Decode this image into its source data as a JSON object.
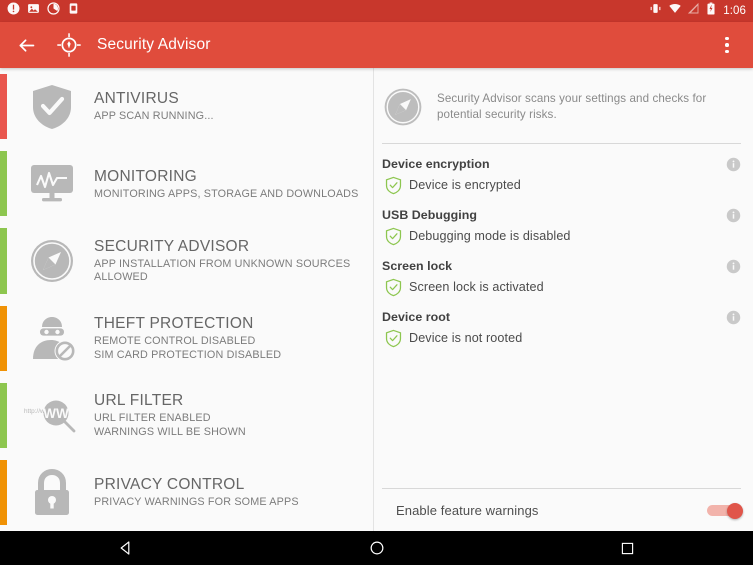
{
  "statusbar": {
    "icons_left": [
      "alert-circle-icon",
      "image-icon",
      "circle-progress-icon",
      "sim-card-icon"
    ],
    "icons_right": [
      "vibrate-icon",
      "wifi-icon",
      "signal-off-icon",
      "battery-icon"
    ],
    "clock": "1:06"
  },
  "appbar": {
    "back_icon": "back-arrow-icon",
    "logo_icon": "compass-target-icon",
    "title": "Security Advisor",
    "overflow_icon": "overflow-menu-icon",
    "background": "#e04c3c"
  },
  "colors": {
    "status_red": "#e9564e",
    "status_green": "#8dc64f",
    "status_orange": "#f09205",
    "accent": "#e04c3c",
    "check_green": "#8dc64f"
  },
  "sidebar": {
    "items": [
      {
        "title": "ANTIVIRUS",
        "lines": [
          "APP SCAN RUNNING..."
        ],
        "icon": "shield-check-icon",
        "stripe_color": "#e9564e"
      },
      {
        "title": "MONITORING",
        "lines": [
          "MONITORING APPS, STORAGE AND DOWNLOADS"
        ],
        "icon": "monitor-graph-icon",
        "stripe_color": "#8dc64f"
      },
      {
        "title": "SECURITY ADVISOR",
        "lines": [
          "APP INSTALLATION FROM UNKNOWN SOURCES",
          "ALLOWED"
        ],
        "icon": "compass-icon",
        "stripe_color": "#8dc64f"
      },
      {
        "title": "THEFT PROTECTION",
        "lines": [
          "REMOTE CONTROL DISABLED",
          "SIM CARD PROTECTION DISABLED"
        ],
        "icon": "thief-blocked-icon",
        "stripe_color": "#f09205"
      },
      {
        "title": "URL FILTER",
        "lines": [
          "URL FILTER ENABLED",
          "WARNINGS WILL BE SHOWN"
        ],
        "icon": "url-magnifier-icon",
        "icon_label": "http://w",
        "icon_label2": "WW",
        "stripe_color": "#8dc64f"
      },
      {
        "title": "PRIVACY CONTROL",
        "lines": [
          "PRIVACY WARNINGS FOR SOME APPS"
        ],
        "icon": "padlock-icon",
        "stripe_color": "#f09205"
      }
    ]
  },
  "detail": {
    "header_icon": "compass-icon",
    "description": "Security Advisor scans your settings and checks for potential security risks.",
    "checks": [
      {
        "title": "Device encryption",
        "status": "Device is encrypted",
        "state_icon": "shield-check-green-icon",
        "info_icon": "info-icon"
      },
      {
        "title": "USB Debugging",
        "status": "Debugging mode is disabled",
        "state_icon": "shield-check-green-icon",
        "info_icon": "info-icon"
      },
      {
        "title": "Screen lock",
        "status": "Screen lock is activated",
        "state_icon": "shield-check-green-icon",
        "info_icon": "info-icon"
      },
      {
        "title": "Device root",
        "status": "Device is not rooted",
        "state_icon": "shield-check-green-icon",
        "info_icon": "info-icon"
      }
    ],
    "footer": {
      "switch_label": "Enable feature warnings",
      "switch_on": "on"
    }
  },
  "navbar": {
    "back": "nav-back-icon",
    "home": "nav-home-icon",
    "recents": "nav-recents-icon"
  }
}
